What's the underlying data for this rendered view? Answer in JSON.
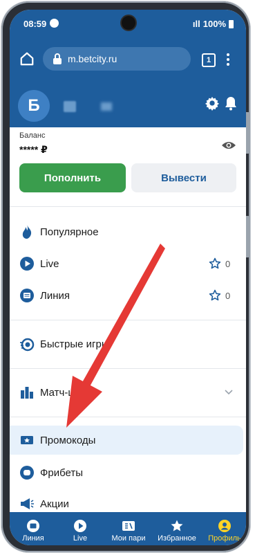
{
  "status_bar": {
    "time": "08:59",
    "signal": "ıll",
    "battery": "100%"
  },
  "browser": {
    "url": "m.betcity.ru",
    "tab_count": "1"
  },
  "site": {
    "logo_letter": "Б"
  },
  "balance": {
    "label": "Баланс",
    "value": "***** ₽",
    "deposit_label": "Пополнить",
    "withdraw_label": "Вывести"
  },
  "menu": {
    "popular": "Популярное",
    "live": "Live",
    "live_count": "0",
    "line": "Линия",
    "line_count": "0",
    "fast_games": "Быстрые игры",
    "match_center": "Матч-центр",
    "promocodes": "Промокоды",
    "freebets": "Фрибеты",
    "promos": "Акции"
  },
  "bottom_nav": {
    "items": [
      {
        "label": "Линия",
        "icon": "line-icon"
      },
      {
        "label": "Live",
        "icon": "live-icon"
      },
      {
        "label": "Мои пари",
        "icon": "my-bets-icon"
      },
      {
        "label": "Избранное",
        "icon": "favorites-icon"
      },
      {
        "label": "Профиль",
        "icon": "profile-icon"
      }
    ],
    "active_index": 4
  },
  "colors": {
    "brand_blue": "#1e5d9c",
    "green_button": "#3a9d4d",
    "active_nav": "#ffd426",
    "arrow": "#e53935"
  }
}
